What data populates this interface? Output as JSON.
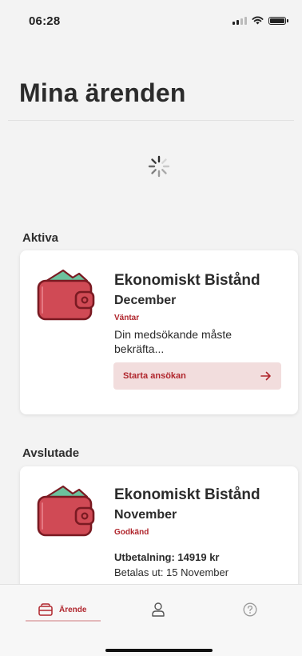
{
  "status_bar": {
    "time": "06:28"
  },
  "header": {
    "title": "Mina ärenden"
  },
  "sections": {
    "active_label": "Aktiva",
    "closed_label": "Avslutade"
  },
  "active_card": {
    "title": "Ekonomiskt Bistånd",
    "month": "December",
    "status": "Väntar",
    "description": "Din medsökande måste bekräfta...",
    "button_label": "Starta ansökan",
    "icon": "wallet-icon"
  },
  "closed_card": {
    "title": "Ekonomiskt Bistånd",
    "month": "November",
    "status": "Godkänd",
    "payout_amount": "Utbetalning: 14919 kr",
    "payout_date": "Betalas ut: 15 November",
    "icon": "wallet-icon"
  },
  "tab_bar": {
    "tabs": [
      {
        "label": "Ärende",
        "icon": "case-icon",
        "active": true
      },
      {
        "label": "",
        "icon": "profile-icon",
        "active": false
      },
      {
        "label": "",
        "icon": "help-icon",
        "active": false
      }
    ]
  },
  "colors": {
    "accent": "#b0262d",
    "button_bg": "#f2dddd",
    "wallet_red": "#d04a55",
    "wallet_dark": "#7a1a22",
    "wallet_green": "#6cc19d"
  }
}
